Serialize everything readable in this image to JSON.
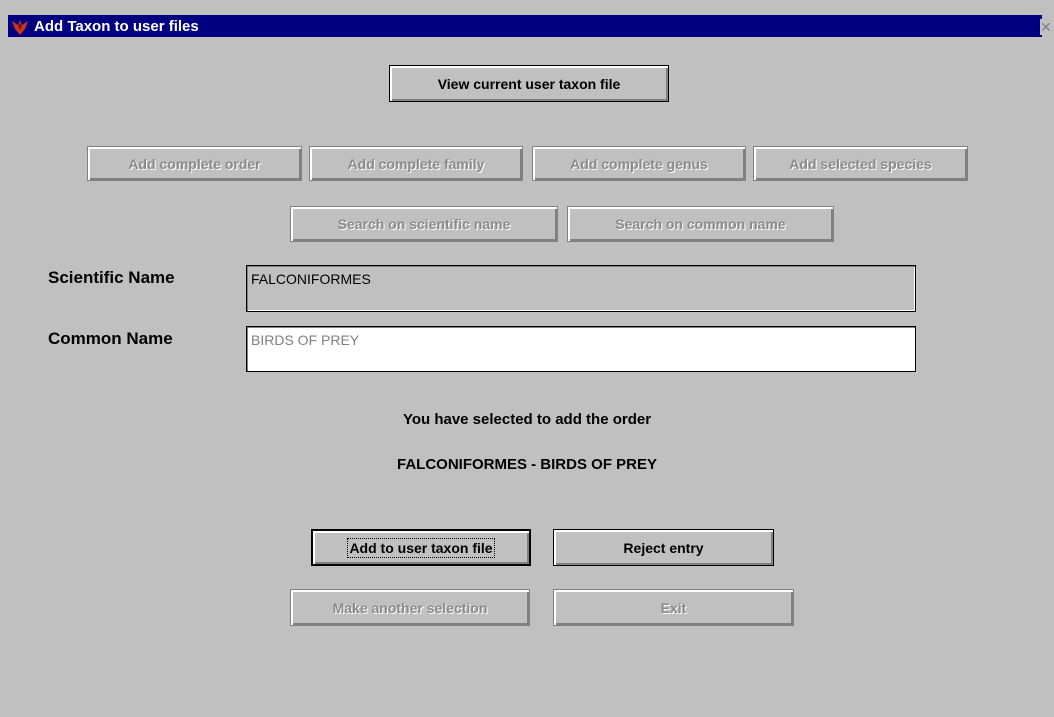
{
  "window": {
    "title": "Add Taxon to user files",
    "close_glyph": "✕"
  },
  "icons": {
    "app": "bird-app-icon",
    "close": "close-icon"
  },
  "buttons": {
    "view_current": "View current user taxon file",
    "add_order": "Add complete order",
    "add_family": "Add complete family",
    "add_genus": "Add complete genus",
    "add_species": "Add selected species",
    "search_scientific": "Search on scientific name",
    "search_common": "Search on common name",
    "add_to_file": "Add to user taxon file",
    "reject": "Reject entry",
    "make_another": "Make another selection",
    "exit": "Exit"
  },
  "fields": {
    "scientific_label": "Scientific Name",
    "scientific_value": "FALCONIFORMES",
    "common_label": "Common Name",
    "common_value": "BIRDS OF PREY"
  },
  "messages": {
    "line1": "You have selected to add the order",
    "line2": "FALCONIFORMES - BIRDS OF PREY"
  },
  "colors": {
    "titlebar": "#000080",
    "face": "#c0c0c0",
    "disabled_text": "#8a8a8a"
  }
}
